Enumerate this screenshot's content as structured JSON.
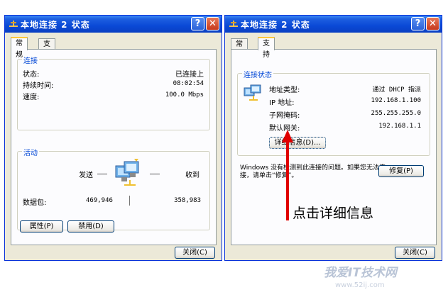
{
  "left_window": {
    "title": "本地连接 2 状态",
    "help_button": "?",
    "close_button": "✕",
    "tabs": [
      "常规",
      "支持"
    ],
    "connection_group": {
      "title": "连接",
      "rows": [
        {
          "label": "状态:",
          "value": "已连接上"
        },
        {
          "label": "持续时间:",
          "value": "08:02:54"
        },
        {
          "label": "速度:",
          "value": "100.0 Mbps"
        }
      ]
    },
    "activity_group": {
      "title": "活动",
      "sent_label": "发送",
      "received_label": "收到",
      "packets_label": "数据包:",
      "packets_sent": "469,946",
      "packets_received": "358,983"
    },
    "properties_button": "属性(P)",
    "disable_button": "禁用(D)",
    "close_dialog_button": "关闭(C)"
  },
  "right_window": {
    "title": "本地连接 2 状态",
    "help_button": "?",
    "close_button": "✕",
    "tabs": [
      "常规",
      "支持"
    ],
    "status_group": {
      "title": "连接状态",
      "rows": [
        {
          "label": "地址类型:",
          "value": "通过 DHCP 指派"
        },
        {
          "label": "IP 地址:",
          "value": "192.168.1.100"
        },
        {
          "label": "子网掩码:",
          "value": "255.255.255.0"
        },
        {
          "label": "默认网关:",
          "value": "192.168.1.1"
        }
      ],
      "details_button": "详细信息(D)..."
    },
    "repair_text": "Windows 没有检测到此连接的问题。如果您无法连接，请单击“修复”。",
    "repair_button": "修复(P)",
    "close_dialog_button": "关闭(C)"
  },
  "annotation": "点击详细信息",
  "watermark": {
    "text": "我爱IT技术网",
    "url": "www.52ij.com"
  },
  "colors": {
    "titlebar": "#0a49d6",
    "group_title": "#0046d5",
    "arrow": "#e00000",
    "tab_highlight": "#ffc83c"
  }
}
